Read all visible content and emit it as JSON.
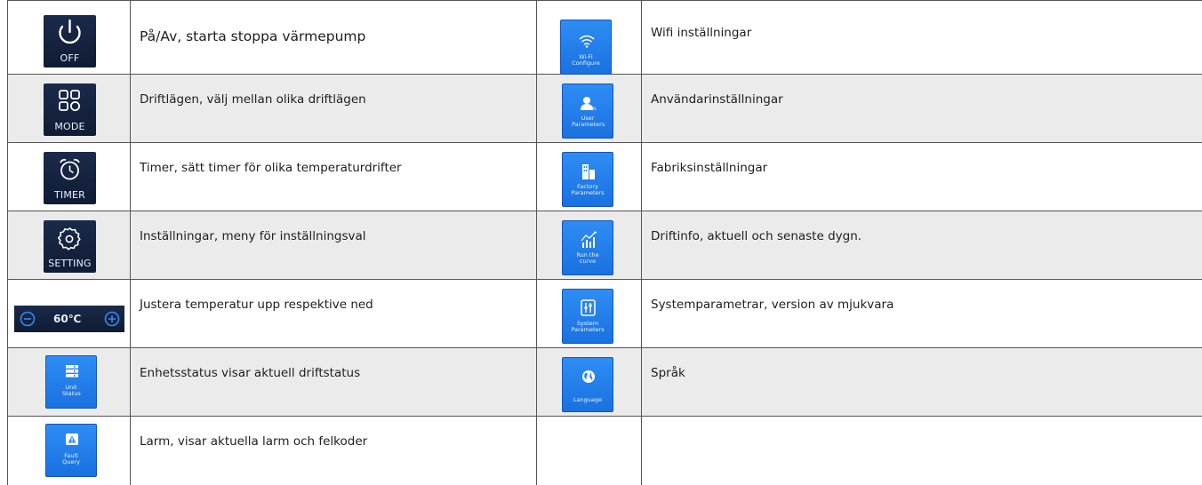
{
  "left": [
    {
      "icon": "power-icon",
      "caption": "OFF",
      "text": "På/Av, starta stoppa värmepump"
    },
    {
      "icon": "mode-icon",
      "caption": "MODE",
      "text": "Driftlägen, välj mellan olika driftlägen"
    },
    {
      "icon": "alarm-clock-icon",
      "caption": "TIMER",
      "text": "Timer, sätt timer för olika temperaturdrifter"
    },
    {
      "icon": "gear-icon",
      "caption": "SETTING",
      "text": "Inställningar, meny för inställningsval"
    },
    {
      "icon": "temperature-adjust-icon",
      "caption": "60℃",
      "text": "Justera temperatur upp respektive ned"
    },
    {
      "icon": "unit-status-icon",
      "caption": "Unit Status",
      "text": "Enhetsstatus visar aktuell driftstatus"
    },
    {
      "icon": "fault-query-icon",
      "caption": "Fault Query",
      "text": "Larm, visar aktuella larm och felkoder"
    }
  ],
  "right": [
    {
      "icon": "wifi-icon",
      "caption": "Wi-Fi Configure",
      "text": "Wifi inställningar"
    },
    {
      "icon": "user-parameters-icon",
      "caption": "User Parameters",
      "text": "Användarinställningar"
    },
    {
      "icon": "factory-parameters-icon",
      "caption": "Factory Parameters",
      "text": "Fabriksinställningar"
    },
    {
      "icon": "curve-chart-icon",
      "caption": "Run the curve",
      "text": "Driftinfo, aktuell och senaste dygn."
    },
    {
      "icon": "system-parameters-icon",
      "caption": "System Parameters",
      "text": "Systemparametrar, version av mjukvara"
    },
    {
      "icon": "globe-icon",
      "caption": "Language",
      "text": "Språk"
    },
    {
      "icon": "",
      "caption": "",
      "text": ""
    }
  ]
}
